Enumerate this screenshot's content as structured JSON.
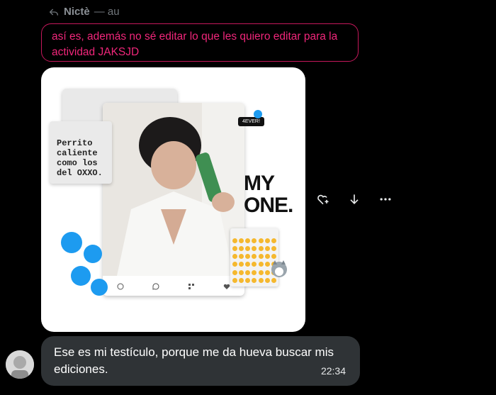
{
  "reply": {
    "name": "Nictè",
    "suffix": "— au"
  },
  "quote": {
    "text": "así es, además no sé editar lo que les quiero editar para la actividad JAKSJD"
  },
  "image": {
    "sticky_note": "Perrito caliente como los del OXXO.",
    "big_text_line1": "MY",
    "big_text_line2": "ONE.",
    "tag": "4EVER!",
    "icons": [
      "user-icon",
      "comment-icon",
      "grid-icon",
      "heart-icon"
    ]
  },
  "actions": [
    {
      "name": "react-icon"
    },
    {
      "name": "download-icon"
    },
    {
      "name": "more-icon"
    }
  ],
  "message": {
    "text": "Ese es mi testículo, porque me da hueva buscar mis ediciones.",
    "time": "22:34"
  },
  "colors": {
    "background": "#000000",
    "quote_border": "#c5185b",
    "quote_text": "#f0267a",
    "bubble": "#2f3336",
    "accent": "#1d9bf0"
  }
}
